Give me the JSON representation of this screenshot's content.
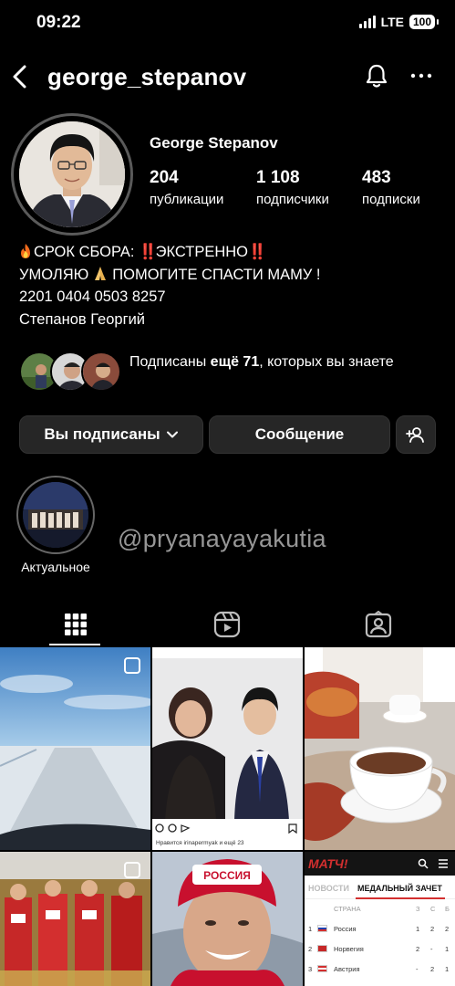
{
  "status_bar": {
    "time": "09:22",
    "network": "LTE",
    "battery": "100"
  },
  "header": {
    "username": "george_stepanov"
  },
  "profile": {
    "full_name": "George Stepanov",
    "stats": [
      {
        "value": "204",
        "label": "публикации"
      },
      {
        "value": "1 108",
        "label": "подписчики"
      },
      {
        "value": "483",
        "label": "подписки"
      }
    ],
    "bio": {
      "line1_a": "СРОК СБОРА: ",
      "line1_bang": "‼️",
      "line1_b": "ЭКСТРЕННО",
      "line2_a": "УМОЛЯЮ",
      "line2_b": "ПОМОГИТЕ СПАСТИ МАМУ !",
      "line3": "2201 0404 0503 8257",
      "line4": "Степанов Георгий"
    },
    "mutual": {
      "prefix": "Подписаны ",
      "count": "ещё 71",
      "suffix": ", которых вы знаете"
    }
  },
  "actions": {
    "following": "Вы подписаны",
    "message": "Сообщение"
  },
  "highlights": [
    {
      "label": "Актуальное"
    }
  ],
  "watermark": "@pryanayayakutia",
  "colors": {
    "background": "#000000",
    "button": "#262626",
    "alert": "#e02020"
  },
  "icons": [
    "back-icon",
    "bell-icon",
    "more-icon",
    "chevron-down-icon",
    "add-person-icon",
    "grid-icon",
    "reels-icon",
    "tagged-icon"
  ],
  "grid_posts": [
    {
      "kind": "road-winter"
    },
    {
      "kind": "couple-photo",
      "likes_text": "Нравится irinapermyak и ещё 23"
    },
    {
      "kind": "coffee-cup"
    },
    {
      "kind": "skiers"
    },
    {
      "kind": "skier-selfie",
      "hat_text": "РОССИЯ"
    },
    {
      "kind": "medal-table",
      "brand": "МАТЧ!",
      "tab_news": "НОВОСТИ",
      "tab_medals": "МЕДАЛЬНЫЙ ЗАЧЕТ",
      "col_country": "СТРАНА",
      "col_headers": [
        "З",
        "С",
        "Б"
      ],
      "rows": [
        {
          "rank": "1",
          "country": "Россия",
          "g": "1",
          "s": "2",
          "b": "2"
        },
        {
          "rank": "2",
          "country": "Норвегия",
          "g": "2",
          "s": "-",
          "b": "1"
        },
        {
          "rank": "3",
          "country": "Австрия",
          "g": "-",
          "s": "2",
          "b": "1"
        }
      ]
    }
  ]
}
